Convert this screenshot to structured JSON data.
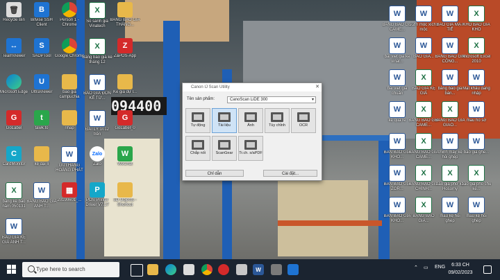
{
  "desktop_left": [
    {
      "label": "Recycle Bin",
      "glyph": "🗑",
      "cls": "g-gray",
      "name": "recycle-bin-icon"
    },
    {
      "label": "Bitvise SSH Client",
      "glyph": "B",
      "cls": "g-blue",
      "name": "bitvise-icon"
    },
    {
      "label": "Person 1 - Chrome",
      "glyph": "",
      "cls": "g-chrome",
      "name": "chrome-icon"
    },
    {
      "label": "So sánh giá Vinatech",
      "glyph": "X",
      "cls": "g-excel",
      "name": "excel-file-icon"
    },
    {
      "label": "BẢNG BÁO GIÁ THÁNG...",
      "glyph": "",
      "cls": "g-folder",
      "name": "folder-icon"
    },
    {
      "label": "TeamViewer",
      "glyph": "↔",
      "cls": "g-blue",
      "name": "teamviewer-icon"
    },
    {
      "label": "SADPTool",
      "glyph": "S",
      "cls": "g-blue",
      "name": "sadptool-icon"
    },
    {
      "label": "Google Chrome",
      "glyph": "",
      "cls": "g-chrome",
      "name": "chrome-icon"
    },
    {
      "label": "Bảng báo giá kế tháng 12",
      "glyph": "X",
      "cls": "g-excel",
      "name": "excel-file-icon"
    },
    {
      "label": "ZaPOS-App",
      "glyph": "Z",
      "cls": "g-red",
      "name": "zapos-icon"
    },
    {
      "label": "Microsoft Edge",
      "glyph": "",
      "cls": "g-edge",
      "name": "edge-icon"
    },
    {
      "label": "UltraViewer",
      "glyph": "U",
      "cls": "g-blue",
      "name": "ultraviewer-icon"
    },
    {
      "label": "báo giá campuchia",
      "glyph": "",
      "cls": "g-folder",
      "name": "folder-icon"
    },
    {
      "label": "BÁO GIÁ ĐỒN KẾ TỪ...",
      "glyph": "W",
      "cls": "g-word",
      "name": "word-file-icon"
    },
    {
      "label": "Kế giá dự l...",
      "glyph": "",
      "cls": "g-folder",
      "name": "folder-icon"
    },
    {
      "label": "GoLabel",
      "glyph": "G",
      "cls": "g-red",
      "name": "golabel-icon"
    },
    {
      "label": "tawk.to",
      "glyph": "t",
      "cls": "g-green",
      "name": "tawkto-icon"
    },
    {
      "label": "nhap",
      "glyph": "",
      "cls": "g-folder",
      "name": "folder-icon"
    },
    {
      "label": "ĐẠI LÝ 1012 trên",
      "glyph": "W",
      "cls": "g-word",
      "name": "word-file-icon"
    },
    {
      "label": "GoLabel_0",
      "glyph": "G",
      "cls": "g-red",
      "name": "golabel-icon"
    },
    {
      "label": "CardMonitor",
      "glyph": "C",
      "cls": "g-teal",
      "name": "cardmonitor-icon"
    },
    {
      "label": "kệ đại lí",
      "glyph": "",
      "cls": "g-folder",
      "name": "folder-icon"
    },
    {
      "label": "GỬI HÀNG HOÀNG PHÁT",
      "glyph": "W",
      "cls": "g-word",
      "name": "word-file-icon"
    },
    {
      "label": "Zalo",
      "glyph": "Zalo",
      "cls": "g-zalo",
      "name": "zalo-icon"
    },
    {
      "label": "WeChat",
      "glyph": "W",
      "cls": "g-green",
      "name": "wechat-icon"
    },
    {
      "label": "bảng kê báo năm 050131",
      "glyph": "X",
      "cls": "g-excel",
      "name": "excel-file-icon"
    },
    {
      "label": "BẢNG BÁO GIÁ ANH T...",
      "glyph": "W",
      "cls": "g-word",
      "name": "word-file-icon"
    },
    {
      "label": "20190601_...",
      "glyph": "▦",
      "cls": "g-red",
      "name": "image-file-icon"
    },
    {
      "label": "POS Printer Driver V7.17",
      "glyph": "P",
      "cls": "g-teal",
      "name": "pos-driver-icon"
    },
    {
      "label": "3D Objects - Shortcut",
      "glyph": "",
      "cls": "g-folder",
      "name": "folder-icon"
    },
    {
      "label": "BÁO GIÁ KỆ GIÁ ANH T...",
      "glyph": "W",
      "cls": "g-word",
      "name": "word-file-icon"
    }
  ],
  "desktop_right": [
    {
      "label": "BẢNG BÁO GIÁ CAME...",
      "glyph": "W",
      "cls": "g-word",
      "name": "word-file-icon"
    },
    {
      "label": "1.2m mộc xích1 mộc",
      "glyph": "W",
      "cls": "g-word",
      "name": "word-file-icon"
    },
    {
      "label": "BÁO GIÁ MẶT TIẾ",
      "glyph": "W",
      "cls": "g-word",
      "name": "word-file-icon"
    },
    {
      "label": "KHO BÁO GIÁ KHO",
      "glyph": "X",
      "cls": "g-excel",
      "name": "excel-file-icon"
    },
    {
      "label": "bài viết giá kế vinat...",
      "glyph": "W",
      "cls": "g-word",
      "name": "word-file-icon"
    },
    {
      "label": "BÁO GIÁ...",
      "glyph": "W",
      "cls": "g-word",
      "name": "word-file-icon"
    },
    {
      "label": "BẢNG BÁO GIÁ CÔNG...",
      "glyph": "W",
      "cls": "g-word",
      "name": "word-file-icon"
    },
    {
      "label": "Microsoft Excel 2010",
      "glyph": "X",
      "cls": "g-excel",
      "name": "excel-app-icon"
    },
    {
      "label": "bài viết giá chuẩn",
      "glyph": "W",
      "cls": "g-word",
      "name": "word-file-icon"
    },
    {
      "label": "BÁO GIÁ KỆ GIÁ",
      "glyph": "X",
      "cls": "g-excel",
      "name": "excel-file-icon"
    },
    {
      "label": "bảng báo giá bàn...",
      "glyph": "W",
      "cls": "g-word",
      "name": "word-file-icon"
    },
    {
      "label": "Mặt khẩu đăng nhập",
      "glyph": "W",
      "cls": "g-word",
      "name": "word-file-icon"
    },
    {
      "label": "kệ quạ re",
      "glyph": "W",
      "cls": "g-word",
      "name": "word-file-icon"
    },
    {
      "label": "BẢNG BÁO GIÁ CAME...",
      "glyph": "X",
      "cls": "g-excel",
      "name": "excel-file-icon"
    },
    {
      "label": "BẢNG BÁO GIÁ GIAO...",
      "glyph": "X",
      "cls": "g-excel",
      "name": "excel-file-icon"
    },
    {
      "label": "mẫu hồ sơ",
      "glyph": "W",
      "cls": "g-word",
      "name": "word-file-icon"
    },
    {
      "label": "BẢN BÁO GIÁ KHO...",
      "glyph": "W",
      "cls": "g-word",
      "name": "word-file-icon"
    },
    {
      "label": "BẢNG BÁO GIÁ CAME...",
      "glyph": "X",
      "cls": "g-excel",
      "name": "excel-file-icon"
    },
    {
      "label": "chinh máy kệ hỏi ghép",
      "glyph": "W",
      "cls": "g-word",
      "name": "word-file-icon"
    },
    {
      "label": "báo giá ghế...",
      "glyph": "W",
      "cls": "g-word",
      "name": "word-file-icon"
    },
    {
      "label": "BẢN BÁO GIÁ ZOR...",
      "glyph": "W",
      "cls": "g-word",
      "name": "word-file-icon"
    },
    {
      "label": "BẢNG BÁO GIÁ CHÍNH...",
      "glyph": "X",
      "cls": "g-excel",
      "name": "excel-file-icon"
    },
    {
      "label": "báo giá phở kệ Hosomy",
      "glyph": "X",
      "cls": "g-excel",
      "name": "excel-file-icon"
    },
    {
      "label": "báo giá phố chu kế...",
      "glyph": "X",
      "cls": "g-excel",
      "name": "excel-file-icon"
    },
    {
      "label": "BẢN BÁO GIÁ KHO...",
      "glyph": "W",
      "cls": "g-word",
      "name": "word-file-icon"
    },
    {
      "label": "BẢNG BÁO GIÁ...",
      "glyph": "X",
      "cls": "g-excel",
      "name": "excel-file-icon"
    },
    {
      "label": "mẫu kệ hỏi ghép",
      "glyph": "W",
      "cls": "g-word",
      "name": "word-file-icon"
    },
    {
      "label": "mẫu kệ hỏi ghép",
      "glyph": "W",
      "cls": "g-word",
      "name": "word-file-icon"
    }
  ],
  "dialog": {
    "title": "Canon IJ Scan Utility",
    "product_label": "Tên sản phẩm:",
    "product_value": "CanoScan LiDE 300",
    "buttons": [
      "Tự động",
      "Tài liệu",
      "Ảnh",
      "Tùy chỉnh",
      "OCR",
      "Chắp nối",
      "ScanGear",
      "Tr.ch. s/aPDF"
    ],
    "instructions_label": "Chỉ dẫn",
    "settings_label": "Cài đặt..."
  },
  "background_text": {
    "counter": "094400"
  },
  "taskbar": {
    "search_placeholder": "Type here to search",
    "language": "ENG",
    "time": "6:33 CH",
    "date": "09/02/2023"
  }
}
